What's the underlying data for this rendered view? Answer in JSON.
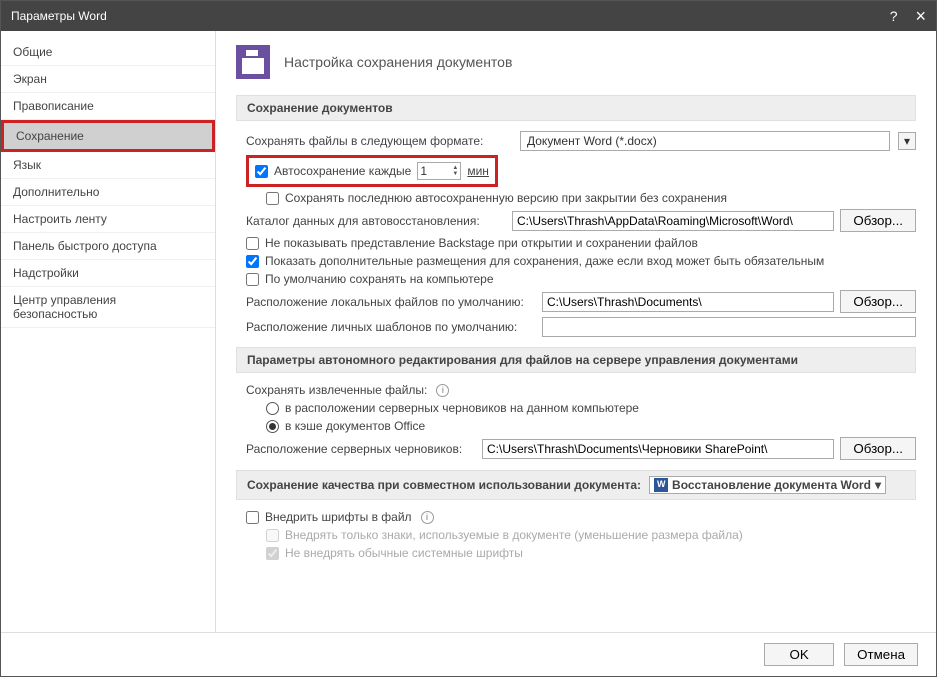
{
  "titlebar": {
    "title": "Параметры Word",
    "help": "?",
    "close": "×"
  },
  "sidebar": {
    "items": [
      "Общие",
      "Экран",
      "Правописание",
      "Сохранение",
      "Язык",
      "Дополнительно",
      "Настроить ленту",
      "Панель быстрого доступа",
      "Надстройки",
      "Центр управления безопасностью"
    ],
    "activeIndex": 3
  },
  "header": {
    "title": "Настройка сохранения документов"
  },
  "sec1": {
    "title": "Сохранение документов",
    "save_format_label": "Сохранять файлы в следующем формате:",
    "save_format_value": "Документ Word (*.docx)",
    "autosave_label": "Автосохранение каждые",
    "autosave_value": "1",
    "autosave_unit": "мин",
    "keep_last_autosaved": "Сохранять последнюю автосохраненную версию при закрытии без сохранения",
    "autorecover_label": "Каталог данных для автовосстановления:",
    "autorecover_path": "C:\\Users\\Thrash\\AppData\\Roaming\\Microsoft\\Word\\",
    "no_backstage": "Не показывать представление Backstage при открытии и сохранении файлов",
    "show_additional": "Показать дополнительные размещения для сохранения, даже если вход может быть обязательным",
    "save_to_pc": "По умолчанию сохранять на компьютере",
    "local_files_label": "Расположение локальных файлов по умолчанию:",
    "local_files_path": "C:\\Users\\Thrash\\Documents\\",
    "templates_label": "Расположение личных шаблонов по умолчанию:",
    "templates_path": "",
    "browse": "Обзор..."
  },
  "sec2": {
    "title": "Параметры автономного редактирования для файлов на сервере управления документами",
    "save_extracted_label": "Сохранять извлеченные файлы:",
    "opt1": "в расположении серверных черновиков на данном компьютере",
    "opt2": "в кэше документов Office",
    "drafts_label": "Расположение серверных черновиков:",
    "drafts_path": "C:\\Users\\Thrash\\Documents\\Черновики SharePoint\\",
    "browse": "Обзор..."
  },
  "sec3": {
    "title": "Сохранение качества при совместном использовании документа:",
    "doc_name": "Восстановление документа Word",
    "embed_fonts": "Внедрить шрифты в файл",
    "embed_used_only": "Внедрять только знаки, используемые в документе (уменьшение размера файла)",
    "no_system_fonts": "Не внедрять обычные системные шрифты"
  },
  "footer": {
    "ok": "OK",
    "cancel": "Отмена"
  }
}
